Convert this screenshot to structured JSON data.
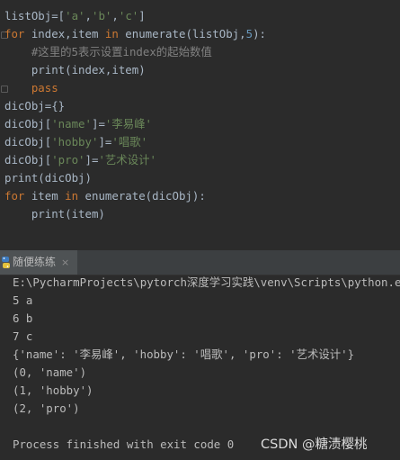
{
  "editor": {
    "lines": [
      [
        {
          "t": "listObj=[",
          "c": "n"
        },
        {
          "t": "'a'",
          "c": "s"
        },
        {
          "t": ",",
          "c": "n"
        },
        {
          "t": "'b'",
          "c": "s"
        },
        {
          "t": ",",
          "c": "n"
        },
        {
          "t": "'c'",
          "c": "s"
        },
        {
          "t": "]",
          "c": "n"
        }
      ],
      [
        {
          "t": "for",
          "c": "k"
        },
        {
          "t": " index,item ",
          "c": "n"
        },
        {
          "t": "in",
          "c": "k"
        },
        {
          "t": " enumerate(listObj,",
          "c": "n"
        },
        {
          "t": "5",
          "c": "d"
        },
        {
          "t": "):",
          "c": "n"
        }
      ],
      [
        {
          "t": "    #这里的5表示设置index的起始数值",
          "c": "m"
        }
      ],
      [
        {
          "t": "    print(index,item)",
          "c": "n"
        }
      ],
      [
        {
          "t": "    ",
          "c": "n"
        },
        {
          "t": "pass",
          "c": "k"
        }
      ],
      [
        {
          "t": "dicObj={}",
          "c": "n"
        }
      ],
      [
        {
          "t": "dicObj[",
          "c": "n"
        },
        {
          "t": "'name'",
          "c": "s"
        },
        {
          "t": "]=",
          "c": "n"
        },
        {
          "t": "'李易峰'",
          "c": "s"
        }
      ],
      [
        {
          "t": "dicObj[",
          "c": "n"
        },
        {
          "t": "'hobby'",
          "c": "s"
        },
        {
          "t": "]=",
          "c": "n"
        },
        {
          "t": "'唱歌'",
          "c": "s"
        }
      ],
      [
        {
          "t": "dicObj[",
          "c": "n"
        },
        {
          "t": "'pro'",
          "c": "s"
        },
        {
          "t": "]=",
          "c": "n"
        },
        {
          "t": "'艺术设计'",
          "c": "s"
        }
      ],
      [
        {
          "t": "print(dicObj)",
          "c": "n"
        }
      ],
      [
        {
          "t": "for",
          "c": "k"
        },
        {
          "t": " item ",
          "c": "n"
        },
        {
          "t": "in",
          "c": "k"
        },
        {
          "t": " enumerate(dicObj):",
          "c": "n"
        }
      ],
      [
        {
          "t": "    print(item)",
          "c": "n"
        }
      ]
    ]
  },
  "run_panel": {
    "tab_label": "随便练练",
    "close_symbol": "×"
  },
  "console": {
    "lines": [
      "E:\\PycharmProjects\\pytorch深度学习实践\\venv\\Scripts\\python.exe",
      "5 a",
      "6 b",
      "7 c",
      "{'name': '李易峰', 'hobby': '唱歌', 'pro': '艺术设计'}",
      "(0, 'name')",
      "(1, 'hobby')",
      "(2, 'pro')",
      "",
      "Process finished with exit code 0"
    ]
  },
  "watermark": "CSDN @糖渍樱桃",
  "colors": {
    "background": "#2b2b2b",
    "keyword": "#cc7832",
    "string": "#6a8759",
    "number": "#6897bb",
    "comment": "#808080",
    "text": "#a9b7c6"
  }
}
